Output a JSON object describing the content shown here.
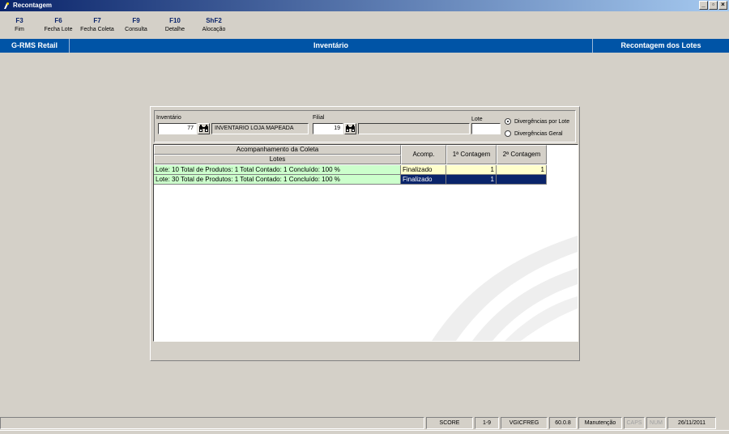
{
  "window": {
    "title": "Recontagem",
    "controls": [
      "_",
      "▫",
      "×"
    ]
  },
  "function_keys": [
    {
      "key": "F3",
      "label": "Fim"
    },
    {
      "key": "F6",
      "label": "Fecha Lote"
    },
    {
      "key": "F7",
      "label": "Fecha Coleta"
    },
    {
      "key": "F9",
      "label": "Consulta"
    },
    {
      "key": "F10",
      "label": "Detalhe"
    },
    {
      "key": "ShF2",
      "label": "Alocação"
    }
  ],
  "header": {
    "app": "G-RMS Retail",
    "module": "Inventário",
    "screen": "Recontagem dos Lotes"
  },
  "filters": {
    "inventario_label": "Inventário",
    "inventario_value": "77",
    "inventario_desc": "INVENTARIO LOJA MAPEADA",
    "filial_label": "Filial",
    "filial_value": "19",
    "filial_desc": "",
    "lote_label": "Lote",
    "lote_value": "",
    "radio_por_lote": "Divergências por Lote",
    "radio_geral": "Divergências Geral",
    "selected": "por_lote"
  },
  "grid": {
    "group_header": "Acompanhamento da Coleta",
    "columns": [
      "Lotes",
      "Acomp.",
      "1ª Contagem",
      "2ª Contagem"
    ],
    "rows": [
      {
        "lote": "Lote: 10 Total de Produtos: 1 Total Contado: 1 Concluído: 100 %",
        "acomp": "Finalizado",
        "c1": "1",
        "c2": "1",
        "selected": false
      },
      {
        "lote": "Lote: 30 Total de Produtos: 1 Total Contado: 1 Concluído: 100 %",
        "acomp": "Finalizado",
        "c1": "1",
        "c2": "",
        "selected": true
      }
    ]
  },
  "status_bar": [
    {
      "text": ""
    },
    {
      "text": "SCORE"
    },
    {
      "text": "1-9"
    },
    {
      "text": "VGICFREG"
    },
    {
      "text": "60.0.8"
    },
    {
      "text": "Manutenção"
    },
    {
      "text": "CAPS"
    },
    {
      "text": "NUM"
    },
    {
      "text": "26/11/2011"
    }
  ],
  "colors": {
    "title_bar": "#0a246a",
    "module_bar": "#0054a6",
    "row_green": "#ccffcc",
    "row_yellow": "#ffffcc",
    "row_selected": "#0a246a"
  }
}
